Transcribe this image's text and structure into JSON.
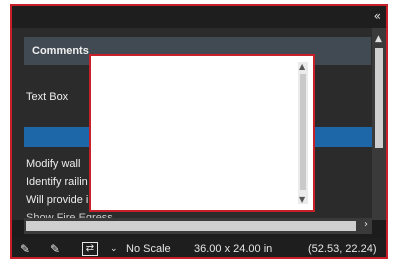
{
  "header": {
    "collapse_icon": "«"
  },
  "panel": {
    "title": "Comments",
    "text_box_label": "Text Box",
    "rows": [
      "Modify wall",
      "Identify railin",
      "Will provide i",
      "Show Fire Egress"
    ]
  },
  "status_bar": {
    "scale_label": "No Scale",
    "dimensions": "36.00 x 24.00 in",
    "coordinates": "(52.53, 22.24)"
  }
}
